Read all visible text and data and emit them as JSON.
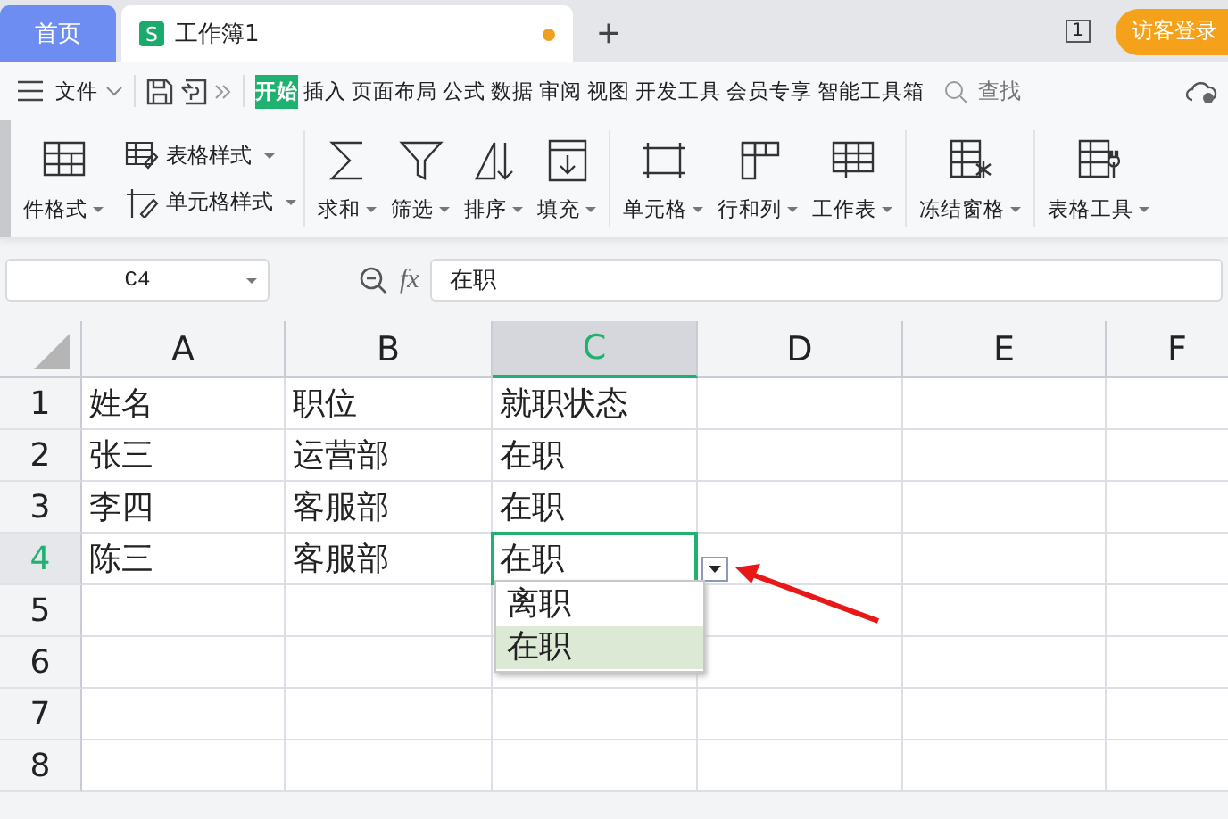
{
  "tabs": [
    {
      "label": "首页",
      "kind": "home",
      "selected": false
    },
    {
      "label": "工作簿1",
      "kind": "doc",
      "badge": "S",
      "unsaved": true,
      "selected": true
    }
  ],
  "new_tab": "+",
  "window_count": "1",
  "login_button": "访客登录",
  "menu": {
    "file": "文件",
    "ribbon_tabs": [
      {
        "label": "开始",
        "selected": true
      },
      {
        "label": "插入",
        "selected": false
      },
      {
        "label": "页面布局",
        "selected": false
      },
      {
        "label": "公式",
        "selected": false
      },
      {
        "label": "数据",
        "selected": false
      },
      {
        "label": "审阅",
        "selected": false
      },
      {
        "label": "视图",
        "selected": false
      },
      {
        "label": "开发工具",
        "selected": false
      },
      {
        "label": "会员专享",
        "selected": false
      },
      {
        "label": "智能工具箱",
        "selected": false
      }
    ],
    "search": {
      "placeholder": "查找"
    }
  },
  "ribbon": {
    "groups": [
      {
        "kind": "row",
        "tools": [
          {
            "label": "件格式",
            "kind": "table"
          }
        ]
      },
      {
        "kind": "stack",
        "tools": [
          {
            "label": "表格样式",
            "kind": "style"
          },
          {
            "label": "单元格样式",
            "kind": "brush"
          }
        ]
      },
      {
        "kind": "row",
        "tools": [
          {
            "label": "求和",
            "kind": "sum"
          },
          {
            "label": "筛选",
            "kind": "filter"
          },
          {
            "label": "排序",
            "kind": "sort"
          },
          {
            "label": "填充",
            "kind": "fill"
          }
        ]
      },
      {
        "kind": "row",
        "tools": [
          {
            "label": "单元格",
            "kind": "cell"
          },
          {
            "label": "行和列",
            "kind": "rowcol"
          },
          {
            "label": "工作表",
            "kind": "sheet"
          }
        ]
      },
      {
        "kind": "row",
        "tools": [
          {
            "label": "冻结窗格",
            "kind": "freeze"
          }
        ]
      },
      {
        "kind": "row",
        "tools": [
          {
            "label": "表格工具",
            "kind": "tools"
          }
        ]
      }
    ]
  },
  "formula_bar": {
    "name_box": "C4",
    "fx": "fx",
    "value": "在职"
  },
  "sheet": {
    "columns": [
      {
        "label": "A",
        "selected": false
      },
      {
        "label": "B",
        "selected": false
      },
      {
        "label": "C",
        "selected": true
      },
      {
        "label": "D",
        "selected": false
      },
      {
        "label": "E",
        "selected": false
      },
      {
        "label": "F",
        "selected": false
      }
    ],
    "rows": [
      {
        "label": "1",
        "selected": false,
        "cells": [
          "姓名",
          "职位",
          "就职状态",
          "",
          "",
          ""
        ]
      },
      {
        "label": "2",
        "selected": false,
        "cells": [
          "张三",
          "运营部",
          "在职",
          "",
          "",
          ""
        ]
      },
      {
        "label": "3",
        "selected": false,
        "cells": [
          "李四",
          "客服部",
          "在职",
          "",
          "",
          ""
        ]
      },
      {
        "label": "4",
        "selected": true,
        "cells": [
          "陈三",
          "客服部",
          "在职",
          "",
          "",
          ""
        ]
      },
      {
        "label": "5",
        "selected": false,
        "cells": [
          "",
          "",
          "",
          "",
          "",
          ""
        ]
      },
      {
        "label": "6",
        "selected": false,
        "cells": [
          "",
          "",
          "",
          "",
          "",
          ""
        ]
      },
      {
        "label": "7",
        "selected": false,
        "cells": [
          "",
          "",
          "",
          "",
          "",
          ""
        ]
      },
      {
        "label": "8",
        "selected": false,
        "cells": [
          "",
          "",
          "",
          "",
          "",
          ""
        ]
      }
    ],
    "dropdown": {
      "options": [
        {
          "label": "离职",
          "selected": false
        },
        {
          "label": "在职",
          "selected": true
        }
      ]
    }
  }
}
